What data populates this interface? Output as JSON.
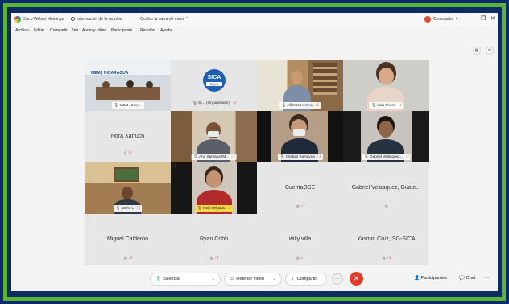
{
  "titlebar": {
    "app_title": "Cisco Webex Meetings",
    "meeting_info": "Información de la reunión",
    "hide_menu": "Ocultar la barra de menú ^",
    "status": "Conectado",
    "minimize": "–",
    "restore": "❐",
    "close": "✕"
  },
  "menu": {
    "items": [
      "Archivo",
      "Editar",
      "Compartir",
      "Ver",
      "Audio y vídeo",
      "Participante",
      "Reunión",
      "Ayuda"
    ]
  },
  "participants": [
    {
      "name": "MEM-NICA...",
      "kind": "video"
    },
    {
      "name": "SI... (Organizador)",
      "kind": "logo",
      "logo_text_1": "SICA",
      "logo_text_2": "Digital"
    },
    {
      "name": "Alfonso Herrera",
      "kind": "video"
    },
    {
      "name": "Aida Flores",
      "kind": "video"
    },
    {
      "name": "Nora Xatruch",
      "kind": "name"
    },
    {
      "name": "Ana Santana (M...",
      "kind": "video"
    },
    {
      "name": "Cristian Samayoa",
      "kind": "video"
    },
    {
      "name": "Gabriel Velasquez...",
      "kind": "video"
    },
    {
      "name": "Mario C",
      "kind": "video"
    },
    {
      "name": "Paúl Delgado",
      "kind": "video"
    },
    {
      "name": "CuentaOSE",
      "kind": "name"
    },
    {
      "name": "Gabriel Velasquez, Guate...",
      "kind": "name"
    },
    {
      "name": "Miguel Calderón",
      "kind": "name"
    },
    {
      "name": "Ryan Cobb",
      "kind": "name"
    },
    {
      "name": "willy villa",
      "kind": "name"
    },
    {
      "name": "Yasmin Cruz, SG-SICA",
      "kind": "name"
    }
  ],
  "banner_text": "MEM | NICARAGUA",
  "toolbar": {
    "mute_label": "Silenciar",
    "stop_video_label": "Detener video",
    "share_label": "Compartir",
    "more_label": "···",
    "end_label": "✕",
    "participants_label": "Participantes",
    "chat_label": "Chat",
    "more_side": "···"
  },
  "colors": {
    "frame_outer": "#0b2a6f",
    "frame_green": "#5cb531",
    "selected_outline": "#2bb5ec",
    "end_button": "#e33b2c",
    "muted_icon": "#d23a2a"
  }
}
